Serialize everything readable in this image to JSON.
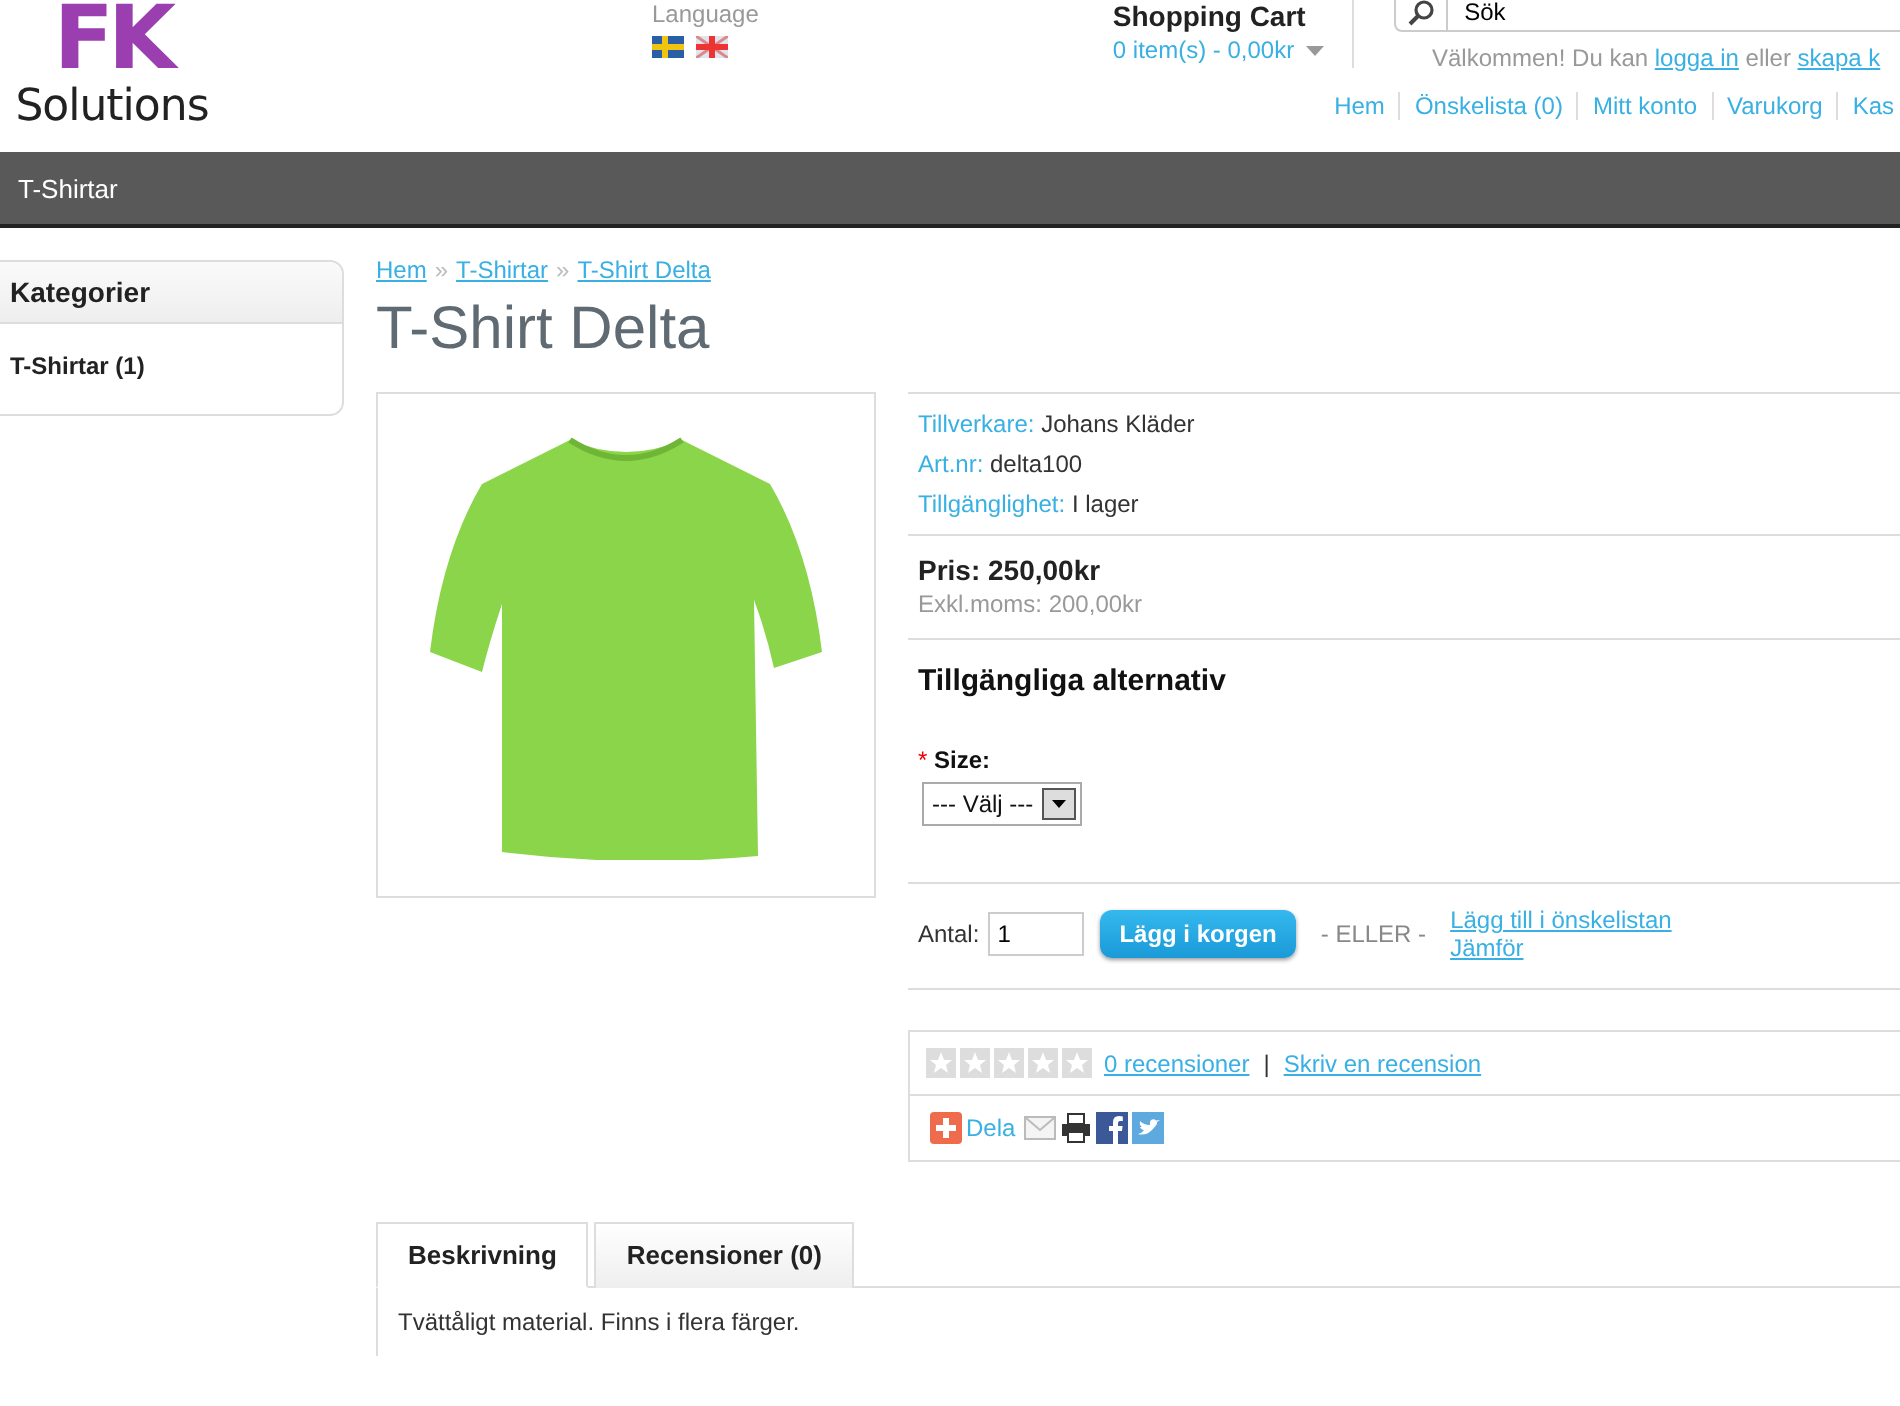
{
  "header": {
    "logo": {
      "letters": "FK",
      "name": "Solutions"
    },
    "language": {
      "label": "Language",
      "flags": [
        {
          "kind": "se"
        },
        {
          "kind": "gb"
        }
      ]
    },
    "cart": {
      "title": "Shopping Cart",
      "summary": "0 item(s) - 0,00kr"
    },
    "search": {
      "value": "Sök"
    },
    "welcome": {
      "before": "Välkommen! Du kan",
      "login_link": "logga in",
      "middle": "eller",
      "register_link": "skapa k"
    },
    "top_links": [
      "Hem",
      "Önskelista (0)",
      "Mitt konto",
      "Varukorg",
      "Kas"
    ]
  },
  "nav": {
    "items": [
      {
        "label": "T-Shirtar"
      }
    ]
  },
  "sidebar": {
    "title": "Kategorier",
    "items": [
      {
        "label": "T-Shirtar (1)"
      }
    ]
  },
  "breadcrumb": {
    "separator": "»",
    "items": [
      "Hem",
      "T-Shirtar",
      "T-Shirt Delta"
    ]
  },
  "product": {
    "title": "T-Shirt Delta",
    "specs": [
      {
        "label": "Tillverkare:",
        "value": "Johans Kläder"
      },
      {
        "label": "Art.nr:",
        "value": "delta100"
      },
      {
        "label": "Tillgänglighet:",
        "value": "I lager"
      }
    ],
    "price": "Pris: 250,00kr",
    "price_ex_tax": "Exkl.moms: 200,00kr",
    "options_title": "Tillgängliga alternativ",
    "option": {
      "required_mark": "*",
      "label": "Size:",
      "value": "--- Välj ---"
    },
    "quantity": {
      "label": "Antal:",
      "value": "1"
    },
    "add_button": "Lägg i korgen",
    "or_text": "- ELLER -",
    "wishlist_link": "Lägg till i önskelistan",
    "compare_link": "Jämför",
    "rating": {
      "stars": 0,
      "reviews_link": "0 recensioner",
      "separator": "|",
      "write_link": "Skriv en recension"
    },
    "share": {
      "label": "Dela"
    },
    "tabs": [
      {
        "label": "Beskrivning",
        "selected": true
      },
      {
        "label": "Recensioner (0)",
        "selected": false
      }
    ],
    "description": "Tvättåligt material. Finns i flera färger."
  }
}
